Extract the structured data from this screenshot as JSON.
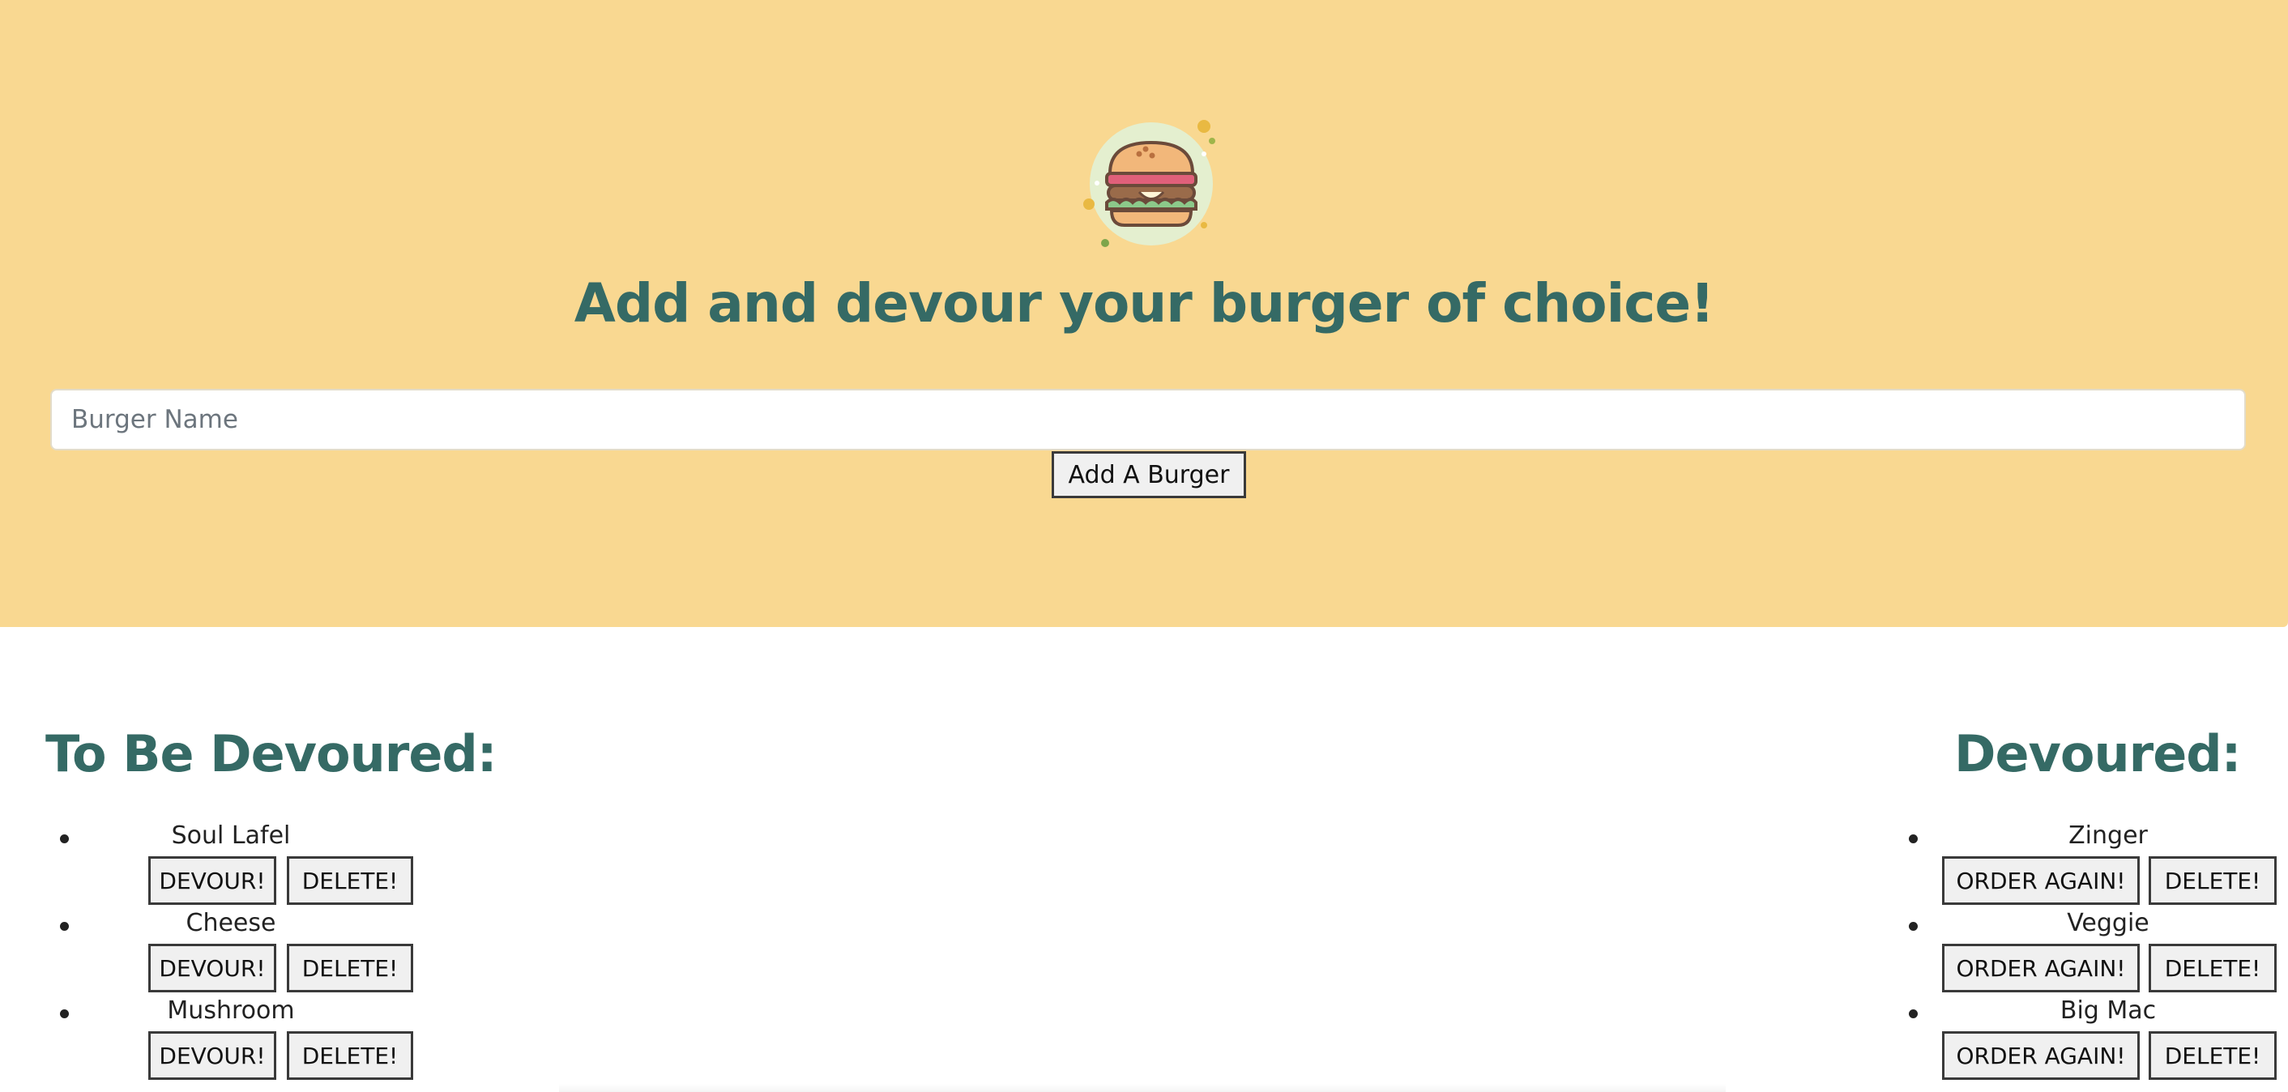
{
  "header": {
    "title": "Add and devour your burger of choice!",
    "logo_icon": "burger-icon"
  },
  "form": {
    "input_placeholder": "Burger Name",
    "input_value": "",
    "add_button_label": "Add A Burger"
  },
  "to_be_devoured": {
    "title": "To Be Devoured:",
    "items": [
      {
        "name": "Soul Lafel",
        "devour_label": "DEVOUR!",
        "delete_label": "DELETE!"
      },
      {
        "name": "Cheese",
        "devour_label": "DEVOUR!",
        "delete_label": "DELETE!"
      },
      {
        "name": "Mushroom",
        "devour_label": "DEVOUR!",
        "delete_label": "DELETE!"
      }
    ]
  },
  "devoured": {
    "title": "Devoured:",
    "items": [
      {
        "name": "Zinger",
        "order_label": "ORDER AGAIN!",
        "delete_label": "DELETE!"
      },
      {
        "name": "Veggie",
        "order_label": "ORDER AGAIN!",
        "delete_label": "DELETE!"
      },
      {
        "name": "Big Mac",
        "order_label": "ORDER AGAIN!",
        "delete_label": "DELETE!"
      }
    ]
  },
  "colors": {
    "hero_background": "#f9d891",
    "heading": "#356a65",
    "button_background": "#f0f0f0"
  }
}
